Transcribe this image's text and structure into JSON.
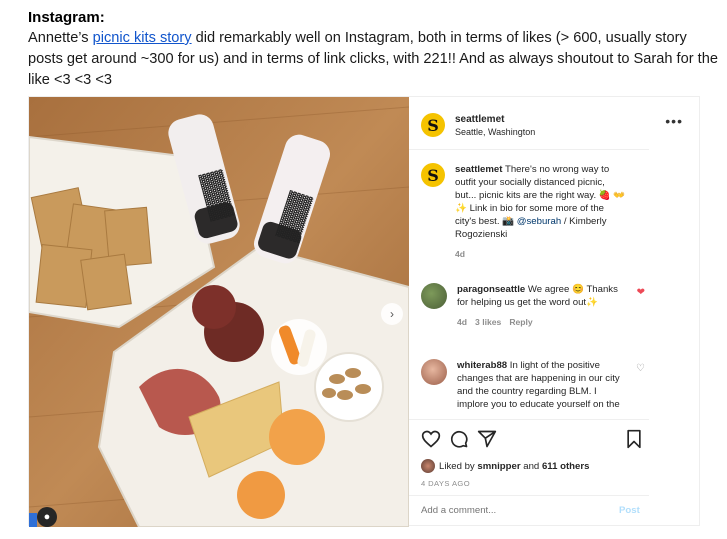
{
  "document": {
    "heading": "Instagram:",
    "para_before": "Annette’s ",
    "link_text": "picnic kits story",
    "para_after": " did remarkably well on Instagram, both in terms of likes (> 600, usually story posts get around ~300 for us) and in terms of link clicks, with 221!! And as always shoutout to Sarah for the like <3 <3 <3"
  },
  "post": {
    "account": "seattlemet",
    "location": "Seattle, Washington",
    "more_icon": "•••",
    "caption_user": "seattlemet",
    "caption_text": " There's no wrong way to outfit your socially distanced picnic, but... picnic kits are the right way. 🍓 👐✨ Link in bio for some more of the city's best. 📸 ",
    "caption_mention": "@seburah",
    "caption_tail": " / Kimberly Rogozienski",
    "caption_age": "4d",
    "comments": [
      {
        "user": "paragonseattle",
        "text": " We agree 😊 Thanks for helping us get the word out✨",
        "age": "4d",
        "likes": "3 likes",
        "reply": "Reply",
        "heart": "❤"
      },
      {
        "user": "whiterab88",
        "text": " In light of the positive changes that are happening in our city and the country regarding BLM. I implore you to educate yourself on the",
        "heart": "♡"
      }
    ],
    "liked_by_prefix": "Liked by ",
    "liked_by_user": "smnipper",
    "liked_by_suffix": " and ",
    "liked_by_count": "611 others",
    "time_ago": "4 DAYS AGO",
    "add_comment_placeholder": "Add a comment...",
    "post_button": "Post",
    "avatar_letter": "S"
  },
  "colors": {
    "link": "#1155cc",
    "brand_yellow": "#f5c300",
    "like_red": "#ed4956",
    "post_blue_disabled": "#b2dffc"
  }
}
